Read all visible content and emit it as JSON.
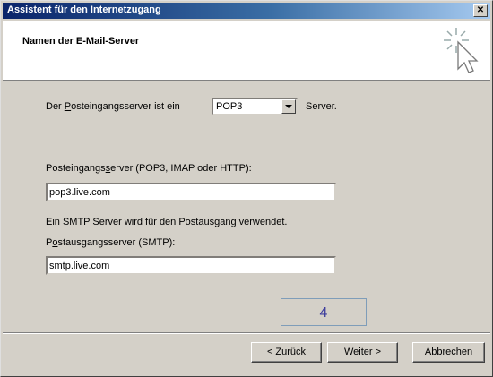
{
  "window": {
    "title": "Assistent für den Internetzugang",
    "close_label": "✕"
  },
  "header": {
    "title": "Namen der E-Mail-Server",
    "icon": "wizard-sparkle-cursor-icon"
  },
  "incoming_type": {
    "label_pre": "Der ",
    "label_key": "P",
    "label_post": "osteingangsserver ist ein",
    "selected": "POP3",
    "suffix": "Server."
  },
  "incoming_server": {
    "label_pre": "Posteingangs",
    "label_key": "s",
    "label_post": "erver (POP3, IMAP oder HTTP):",
    "value": "pop3.live.com"
  },
  "smtp_note": "Ein SMTP Server wird für den Postausgang verwendet.",
  "outgoing_server": {
    "label_pre": "P",
    "label_key": "o",
    "label_post": "stausgangsserver (SMTP):",
    "value": "smtp.live.com"
  },
  "page_number": "4",
  "buttons": {
    "back_pre": "< ",
    "back_key": "Z",
    "back_post": "urück",
    "next_key": "W",
    "next_post": "eiter >",
    "cancel": "Abbrechen"
  }
}
